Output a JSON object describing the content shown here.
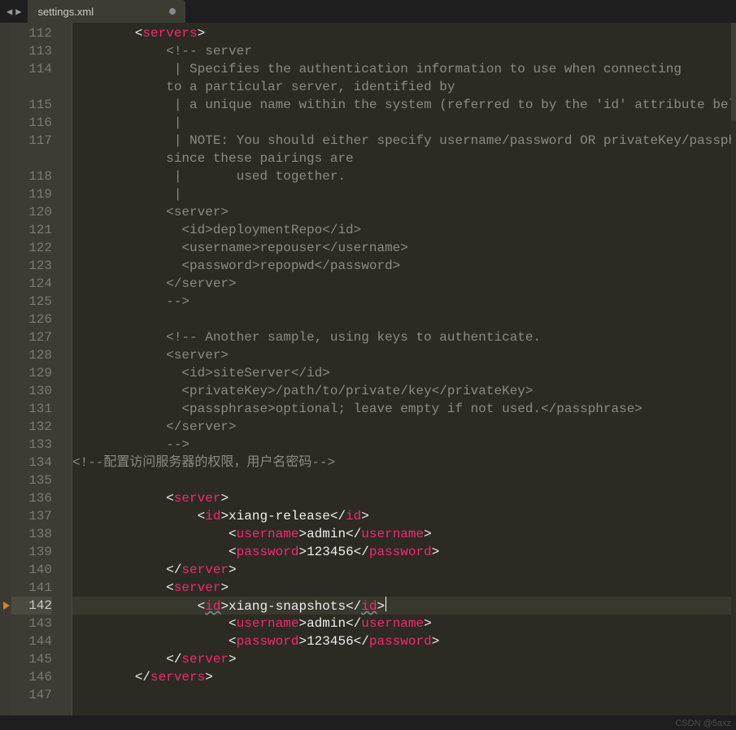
{
  "tab": {
    "filename": "settings.xml",
    "dirty": true
  },
  "gutter": {
    "start": 112,
    "end": 147,
    "active_line": 142
  },
  "code": {
    "lines": [
      {
        "n": 112,
        "indent": 2,
        "kind": "tag-open",
        "tag": "servers"
      },
      {
        "n": 113,
        "indent": 3,
        "kind": "comment",
        "text": "<!-- server"
      },
      {
        "n": 114,
        "indent": 3,
        "kind": "comment",
        "text": " | Specifies the authentication information to use when connecting to a particular server, identified by",
        "wrap_at": 67
      },
      {
        "n": 115,
        "indent": 3,
        "kind": "comment",
        "text": " | a unique name within the system (referred to by the 'id' attribute below)."
      },
      {
        "n": 116,
        "indent": 3,
        "kind": "comment",
        "text": " |"
      },
      {
        "n": 117,
        "indent": 3,
        "kind": "comment",
        "text": " | NOTE: You should either specify username/password OR privateKey/passphrase, since these pairings are",
        "wrap_at": 79
      },
      {
        "n": 118,
        "indent": 3,
        "kind": "comment",
        "text": " |       used together."
      },
      {
        "n": 119,
        "indent": 3,
        "kind": "comment",
        "text": " |"
      },
      {
        "n": 120,
        "indent": 3,
        "kind": "comment",
        "text": "<server>"
      },
      {
        "n": 121,
        "indent": 3,
        "kind": "comment",
        "text": "  <id>deploymentRepo</id>"
      },
      {
        "n": 122,
        "indent": 3,
        "kind": "comment",
        "text": "  <username>repouser</username>"
      },
      {
        "n": 123,
        "indent": 3,
        "kind": "comment",
        "text": "  <password>repopwd</password>"
      },
      {
        "n": 124,
        "indent": 3,
        "kind": "comment",
        "text": "</server>"
      },
      {
        "n": 125,
        "indent": 3,
        "kind": "comment",
        "text": "-->"
      },
      {
        "n": 126,
        "indent": 0,
        "kind": "blank"
      },
      {
        "n": 127,
        "indent": 3,
        "kind": "comment",
        "text": "<!-- Another sample, using keys to authenticate."
      },
      {
        "n": 128,
        "indent": 3,
        "kind": "comment",
        "text": "<server>"
      },
      {
        "n": 129,
        "indent": 3,
        "kind": "comment",
        "text": "  <id>siteServer</id>"
      },
      {
        "n": 130,
        "indent": 3,
        "kind": "comment",
        "text": "  <privateKey>/path/to/private/key</privateKey>"
      },
      {
        "n": 131,
        "indent": 3,
        "kind": "comment",
        "text": "  <passphrase>optional; leave empty if not used.</passphrase>"
      },
      {
        "n": 132,
        "indent": 3,
        "kind": "comment",
        "text": "</server>"
      },
      {
        "n": 133,
        "indent": 3,
        "kind": "comment",
        "text": "-->"
      },
      {
        "n": 134,
        "indent": 0,
        "kind": "comment",
        "text": "<!--配置访问服务器的权限，用户名密码-->"
      },
      {
        "n": 135,
        "indent": 0,
        "kind": "blank"
      },
      {
        "n": 136,
        "indent": 3,
        "kind": "tag-open",
        "tag": "server"
      },
      {
        "n": 137,
        "indent": 4,
        "kind": "elem",
        "tag": "id",
        "text": "xiang-release"
      },
      {
        "n": 138,
        "indent": 5,
        "kind": "elem",
        "tag": "username",
        "text": "admin"
      },
      {
        "n": 139,
        "indent": 5,
        "kind": "elem",
        "tag": "password",
        "text": "123456"
      },
      {
        "n": 140,
        "indent": 3,
        "kind": "tag-close",
        "tag": "server"
      },
      {
        "n": 141,
        "indent": 3,
        "kind": "tag-open",
        "tag": "server"
      },
      {
        "n": 142,
        "indent": 4,
        "kind": "elem-warn",
        "tag": "id",
        "text": "xiang-snapshots",
        "cursor": true
      },
      {
        "n": 143,
        "indent": 5,
        "kind": "elem",
        "tag": "username",
        "text": "admin"
      },
      {
        "n": 144,
        "indent": 5,
        "kind": "elem",
        "tag": "password",
        "text": "123456"
      },
      {
        "n": 145,
        "indent": 3,
        "kind": "tag-close",
        "tag": "server"
      },
      {
        "n": 146,
        "indent": 2,
        "kind": "tag-close",
        "tag": "servers"
      },
      {
        "n": 147,
        "indent": 0,
        "kind": "blank"
      }
    ]
  },
  "watermark": "CSDN @5axz"
}
